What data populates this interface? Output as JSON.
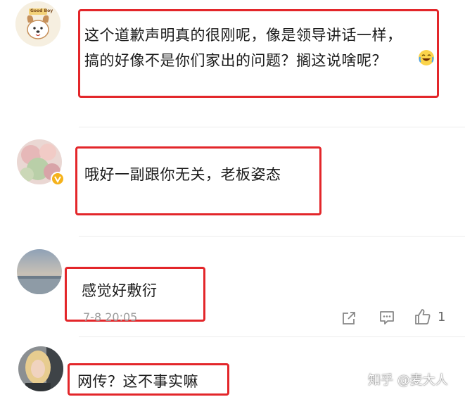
{
  "comments": [
    {
      "lines": [
        "这个道歉声明真的很刚呢，像是领导讲话一样，",
        "搞的好像不是你们家出的问题？搁这说啥呢？"
      ],
      "emoji": "laugh-cry-icon",
      "avatar_text": "Good Boy"
    },
    {
      "lines": [
        "哦好一副跟你无关，老板姿态"
      ]
    },
    {
      "lines": [
        "感觉好敷衍"
      ],
      "time": "7-8 20:05",
      "like_count": "1"
    },
    {
      "lines": [
        "网传？这不事实嘛"
      ]
    }
  ],
  "watermark": "知乎 @麦大人",
  "colors": {
    "highlight": "#e3262a",
    "badge": "#f5b21b",
    "meta": "#9b9b9b"
  }
}
